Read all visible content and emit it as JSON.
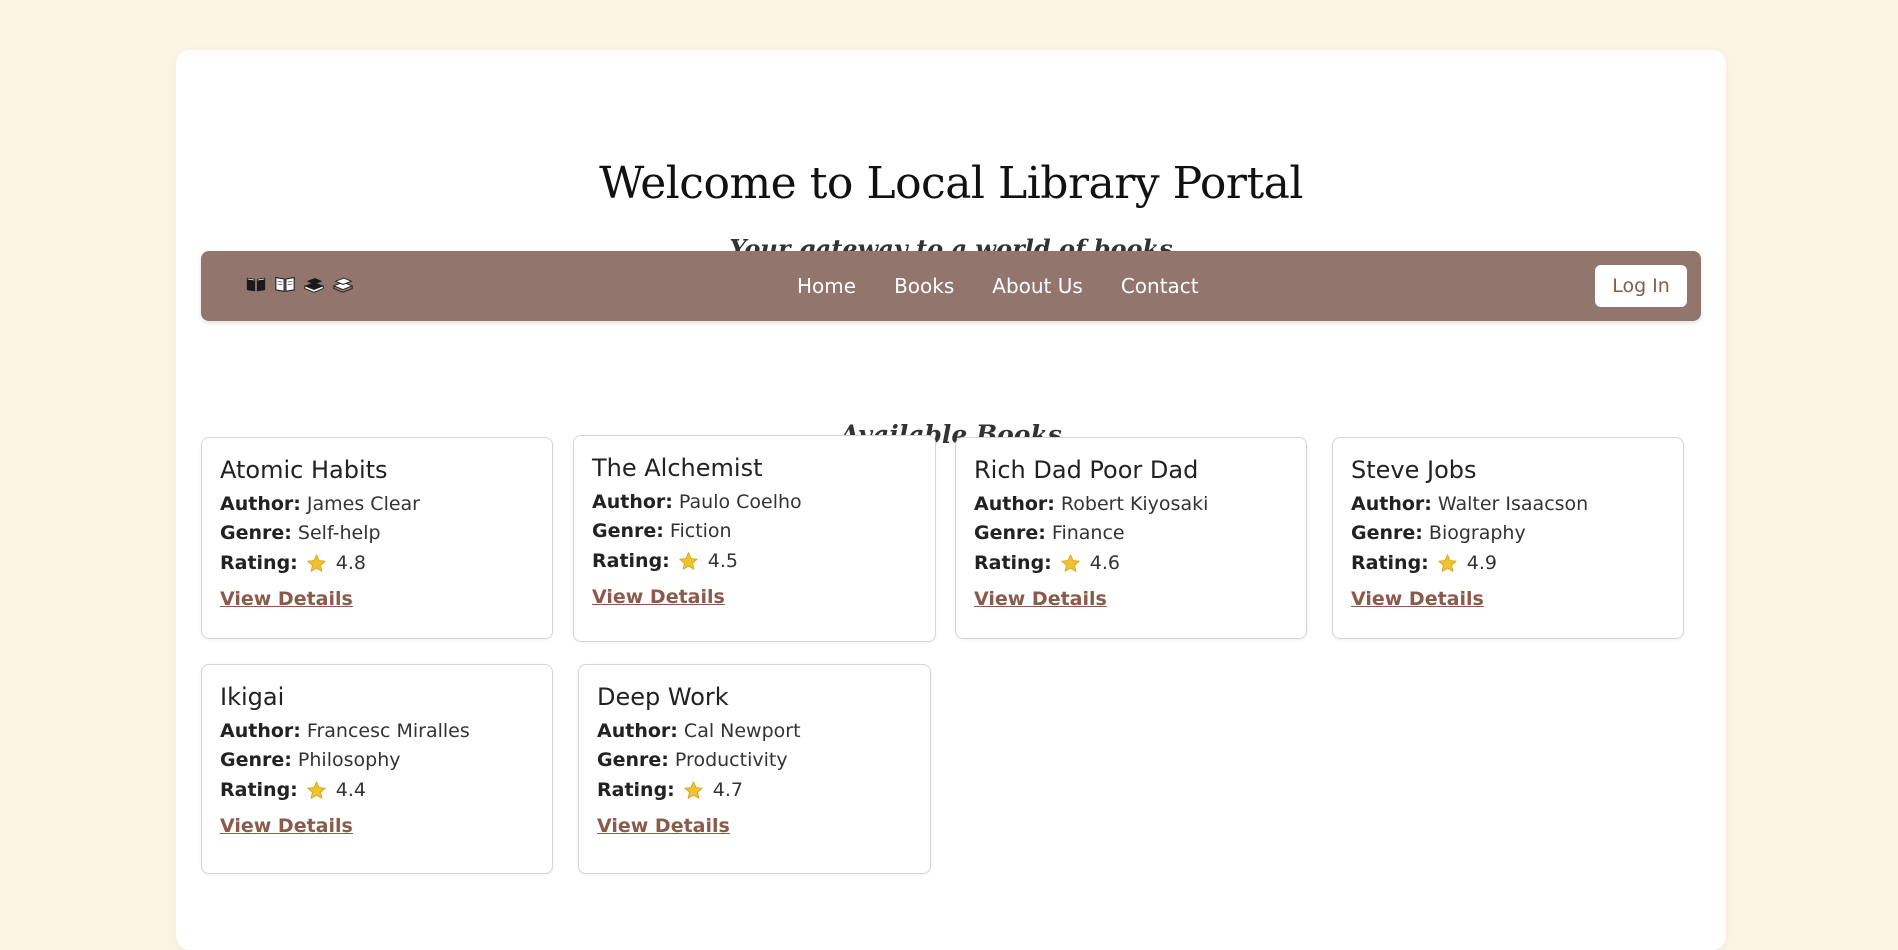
{
  "header": {
    "title": "Welcome to Local Library Portal",
    "subtitle": "Your gateway to a world of books"
  },
  "nav": {
    "logo_icons": [
      "open-book-icon",
      "open-book-icon",
      "book-stack-icon",
      "book-stack-icon"
    ],
    "links": [
      "Home",
      "Books",
      "About Us",
      "Contact"
    ],
    "login_label": "Log In"
  },
  "section": {
    "title": "Available Books"
  },
  "labels": {
    "author": "Author:",
    "genre": "Genre:",
    "rating": "Rating:",
    "view": "View Details"
  },
  "books": [
    {
      "title": "Atomic Habits",
      "author": "James Clear",
      "genre": "Self-help",
      "rating": "4.8"
    },
    {
      "title": "The Alchemist",
      "author": "Paulo Coelho",
      "genre": "Fiction",
      "rating": "4.5"
    },
    {
      "title": "Rich Dad Poor Dad",
      "author": "Robert Kiyosaki",
      "genre": "Finance",
      "rating": "4.6"
    },
    {
      "title": "Steve Jobs",
      "author": "Walter Isaacson",
      "genre": "Biography",
      "rating": "4.9"
    },
    {
      "title": "Ikigai",
      "author": "Francesc Miralles",
      "genre": "Philosophy",
      "rating": "4.4"
    },
    {
      "title": "Deep Work",
      "author": "Cal Newport",
      "genre": "Productivity",
      "rating": "4.7"
    }
  ],
  "colors": {
    "page_bg": "#fdf5e3",
    "nav_bg": "#92766d",
    "link": "#8a5a4a",
    "star": "#f2c12e"
  }
}
